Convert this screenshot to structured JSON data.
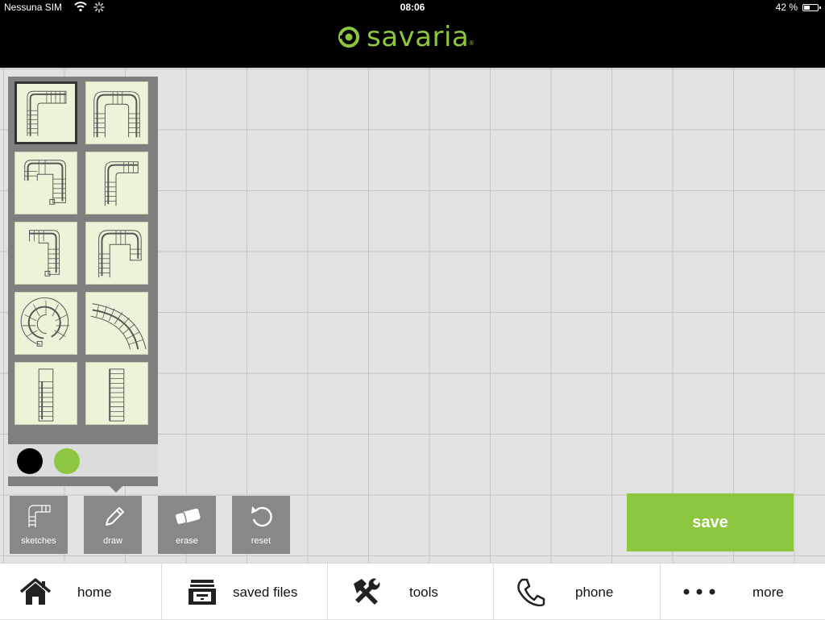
{
  "status_bar": {
    "carrier": "Nessuna SIM",
    "time": "08:06",
    "battery": "42 %"
  },
  "brand": {
    "name": "savaria",
    "mark": "®",
    "color": "#8dc63f"
  },
  "sketches": {
    "templates": [
      {
        "name": "l-shaped-landing"
      },
      {
        "name": "u-shaped-landing"
      },
      {
        "name": "u-shaped-winder-left"
      },
      {
        "name": "l-shaped-winder"
      },
      {
        "name": "l-shaped-winder-right"
      },
      {
        "name": "u-shaped-winder"
      },
      {
        "name": "spiral"
      },
      {
        "name": "curved"
      },
      {
        "name": "straight-landing"
      },
      {
        "name": "straight"
      }
    ],
    "selected_index": 0,
    "colors": [
      "#000000",
      "#8dc63f"
    ]
  },
  "tools": [
    {
      "label": "sketches",
      "icon": "stairs-icon"
    },
    {
      "label": "draw",
      "icon": "pencil-icon"
    },
    {
      "label": "erase",
      "icon": "eraser-icon"
    },
    {
      "label": "reset",
      "icon": "undo-icon"
    }
  ],
  "save_label": "save",
  "nav": [
    {
      "label": "home",
      "icon": "home-icon"
    },
    {
      "label": "saved files",
      "icon": "file-cabinet-icon"
    },
    {
      "label": "tools",
      "icon": "tools-icon"
    },
    {
      "label": "phone",
      "icon": "phone-icon"
    },
    {
      "label": "more",
      "icon": "more-icon"
    }
  ]
}
